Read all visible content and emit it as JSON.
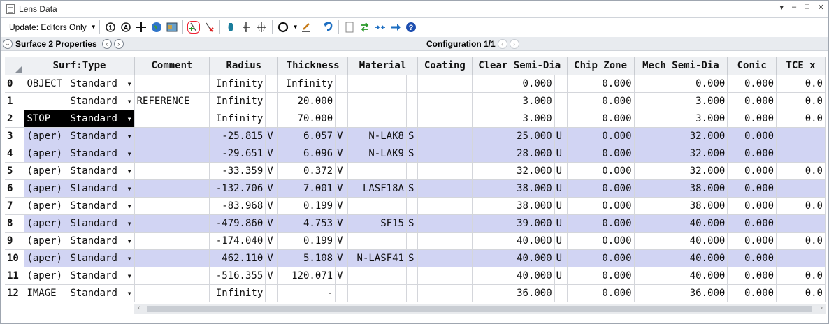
{
  "window": {
    "title": "Lens Data",
    "controls": [
      "▾",
      "–",
      "□",
      "✕"
    ]
  },
  "toolbar": {
    "update_label": "Update: Editors Only",
    "icons": [
      "reload-1-icon",
      "reload-a-icon",
      "crosshair-icon",
      "globe-icon",
      "map-icon",
      "insert-surface-icon",
      "delete-surface-icon",
      "lens-element-icon",
      "add-element-icon",
      "symmetric-element-icon",
      "aperture-icon",
      "make-solve-icon",
      "undo-arrow-icon",
      "page-icon",
      "swap-arrows-icon",
      "collapse-arrows-icon",
      "right-arrow-icon",
      "help-icon"
    ]
  },
  "properties": {
    "title": "Surface 2 Properties",
    "config": "Configuration 1/1"
  },
  "table": {
    "headers": [
      "Surf:Type",
      "Comment",
      "Radius",
      "Thickness",
      "Material",
      "Coating",
      "Clear Semi-Dia",
      "Chip Zone",
      "Mech Semi-Dia",
      "Conic",
      "TCE x"
    ],
    "rows": [
      {
        "n": "0",
        "label": "OBJECT",
        "type": "Standard",
        "comment": "",
        "radius": "Infinity",
        "rflag": "",
        "thick": "Infinity",
        "tflag": "",
        "mat": "",
        "mflag": "",
        "coating": "",
        "clear": "0.000",
        "cflag": "",
        "chip": "0.000",
        "mech": "0.000",
        "conic": "0.000",
        "tce": "0.0",
        "hl": false
      },
      {
        "n": "1",
        "label": "",
        "type": "Standard",
        "comment": "REFERENCE",
        "radius": "Infinity",
        "rflag": "",
        "thick": "20.000",
        "tflag": "",
        "mat": "",
        "mflag": "",
        "coating": "",
        "clear": "3.000",
        "cflag": "",
        "chip": "0.000",
        "mech": "3.000",
        "conic": "0.000",
        "tce": "0.0",
        "hl": false
      },
      {
        "n": "2",
        "label": "STOP",
        "type": "Standard",
        "comment": "",
        "radius": "Infinity",
        "rflag": "",
        "thick": "70.000",
        "tflag": "",
        "mat": "",
        "mflag": "",
        "coating": "",
        "clear": "3.000",
        "cflag": "",
        "chip": "0.000",
        "mech": "3.000",
        "conic": "0.000",
        "tce": "0.0",
        "hl": false,
        "stop": true
      },
      {
        "n": "3",
        "label": "(aper)",
        "type": "Standard",
        "comment": "",
        "radius": "-25.815",
        "rflag": "V",
        "thick": "6.057",
        "tflag": "V",
        "mat": "N-LAK8",
        "mflag": "S",
        "coating": "",
        "clear": "25.000",
        "cflag": "U",
        "chip": "0.000",
        "mech": "32.000",
        "conic": "0.000",
        "tce": "",
        "hl": true
      },
      {
        "n": "4",
        "label": "(aper)",
        "type": "Standard",
        "comment": "",
        "radius": "-29.651",
        "rflag": "V",
        "thick": "6.096",
        "tflag": "V",
        "mat": "N-LAK9",
        "mflag": "S",
        "coating": "",
        "clear": "28.000",
        "cflag": "U",
        "chip": "0.000",
        "mech": "32.000",
        "conic": "0.000",
        "tce": "",
        "hl": true
      },
      {
        "n": "5",
        "label": "(aper)",
        "type": "Standard",
        "comment": "",
        "radius": "-33.359",
        "rflag": "V",
        "thick": "0.372",
        "tflag": "V",
        "mat": "",
        "mflag": "",
        "coating": "",
        "clear": "32.000",
        "cflag": "U",
        "chip": "0.000",
        "mech": "32.000",
        "conic": "0.000",
        "tce": "0.0",
        "hl": false
      },
      {
        "n": "6",
        "label": "(aper)",
        "type": "Standard",
        "comment": "",
        "radius": "-132.706",
        "rflag": "V",
        "thick": "7.001",
        "tflag": "V",
        "mat": "LASF18A",
        "mflag": "S",
        "coating": "",
        "clear": "38.000",
        "cflag": "U",
        "chip": "0.000",
        "mech": "38.000",
        "conic": "0.000",
        "tce": "",
        "hl": true
      },
      {
        "n": "7",
        "label": "(aper)",
        "type": "Standard",
        "comment": "",
        "radius": "-83.968",
        "rflag": "V",
        "thick": "0.199",
        "tflag": "V",
        "mat": "",
        "mflag": "",
        "coating": "",
        "clear": "38.000",
        "cflag": "U",
        "chip": "0.000",
        "mech": "38.000",
        "conic": "0.000",
        "tce": "0.0",
        "hl": false
      },
      {
        "n": "8",
        "label": "(aper)",
        "type": "Standard",
        "comment": "",
        "radius": "-479.860",
        "rflag": "V",
        "thick": "4.753",
        "tflag": "V",
        "mat": "SF15",
        "mflag": "S",
        "coating": "",
        "clear": "39.000",
        "cflag": "U",
        "chip": "0.000",
        "mech": "40.000",
        "conic": "0.000",
        "tce": "",
        "hl": true
      },
      {
        "n": "9",
        "label": "(aper)",
        "type": "Standard",
        "comment": "",
        "radius": "-174.040",
        "rflag": "V",
        "thick": "0.199",
        "tflag": "V",
        "mat": "",
        "mflag": "",
        "coating": "",
        "clear": "40.000",
        "cflag": "U",
        "chip": "0.000",
        "mech": "40.000",
        "conic": "0.000",
        "tce": "0.0",
        "hl": false
      },
      {
        "n": "10",
        "label": "(aper)",
        "type": "Standard",
        "comment": "",
        "radius": "462.110",
        "rflag": "V",
        "thick": "5.108",
        "tflag": "V",
        "mat": "N-LASF41",
        "mflag": "S",
        "coating": "",
        "clear": "40.000",
        "cflag": "U",
        "chip": "0.000",
        "mech": "40.000",
        "conic": "0.000",
        "tce": "",
        "hl": true
      },
      {
        "n": "11",
        "label": "(aper)",
        "type": "Standard",
        "comment": "",
        "radius": "-516.355",
        "rflag": "V",
        "thick": "120.071",
        "tflag": "V",
        "mat": "",
        "mflag": "",
        "coating": "",
        "clear": "40.000",
        "cflag": "U",
        "chip": "0.000",
        "mech": "40.000",
        "conic": "0.000",
        "tce": "0.0",
        "hl": false
      },
      {
        "n": "12",
        "label": "IMAGE",
        "type": "Standard",
        "comment": "",
        "radius": "Infinity",
        "rflag": "",
        "thick": "-",
        "tflag": "",
        "mat": "",
        "mflag": "",
        "coating": "",
        "clear": "36.000",
        "cflag": "",
        "chip": "0.000",
        "mech": "36.000",
        "conic": "0.000",
        "tce": "0.0",
        "hl": false
      }
    ]
  }
}
